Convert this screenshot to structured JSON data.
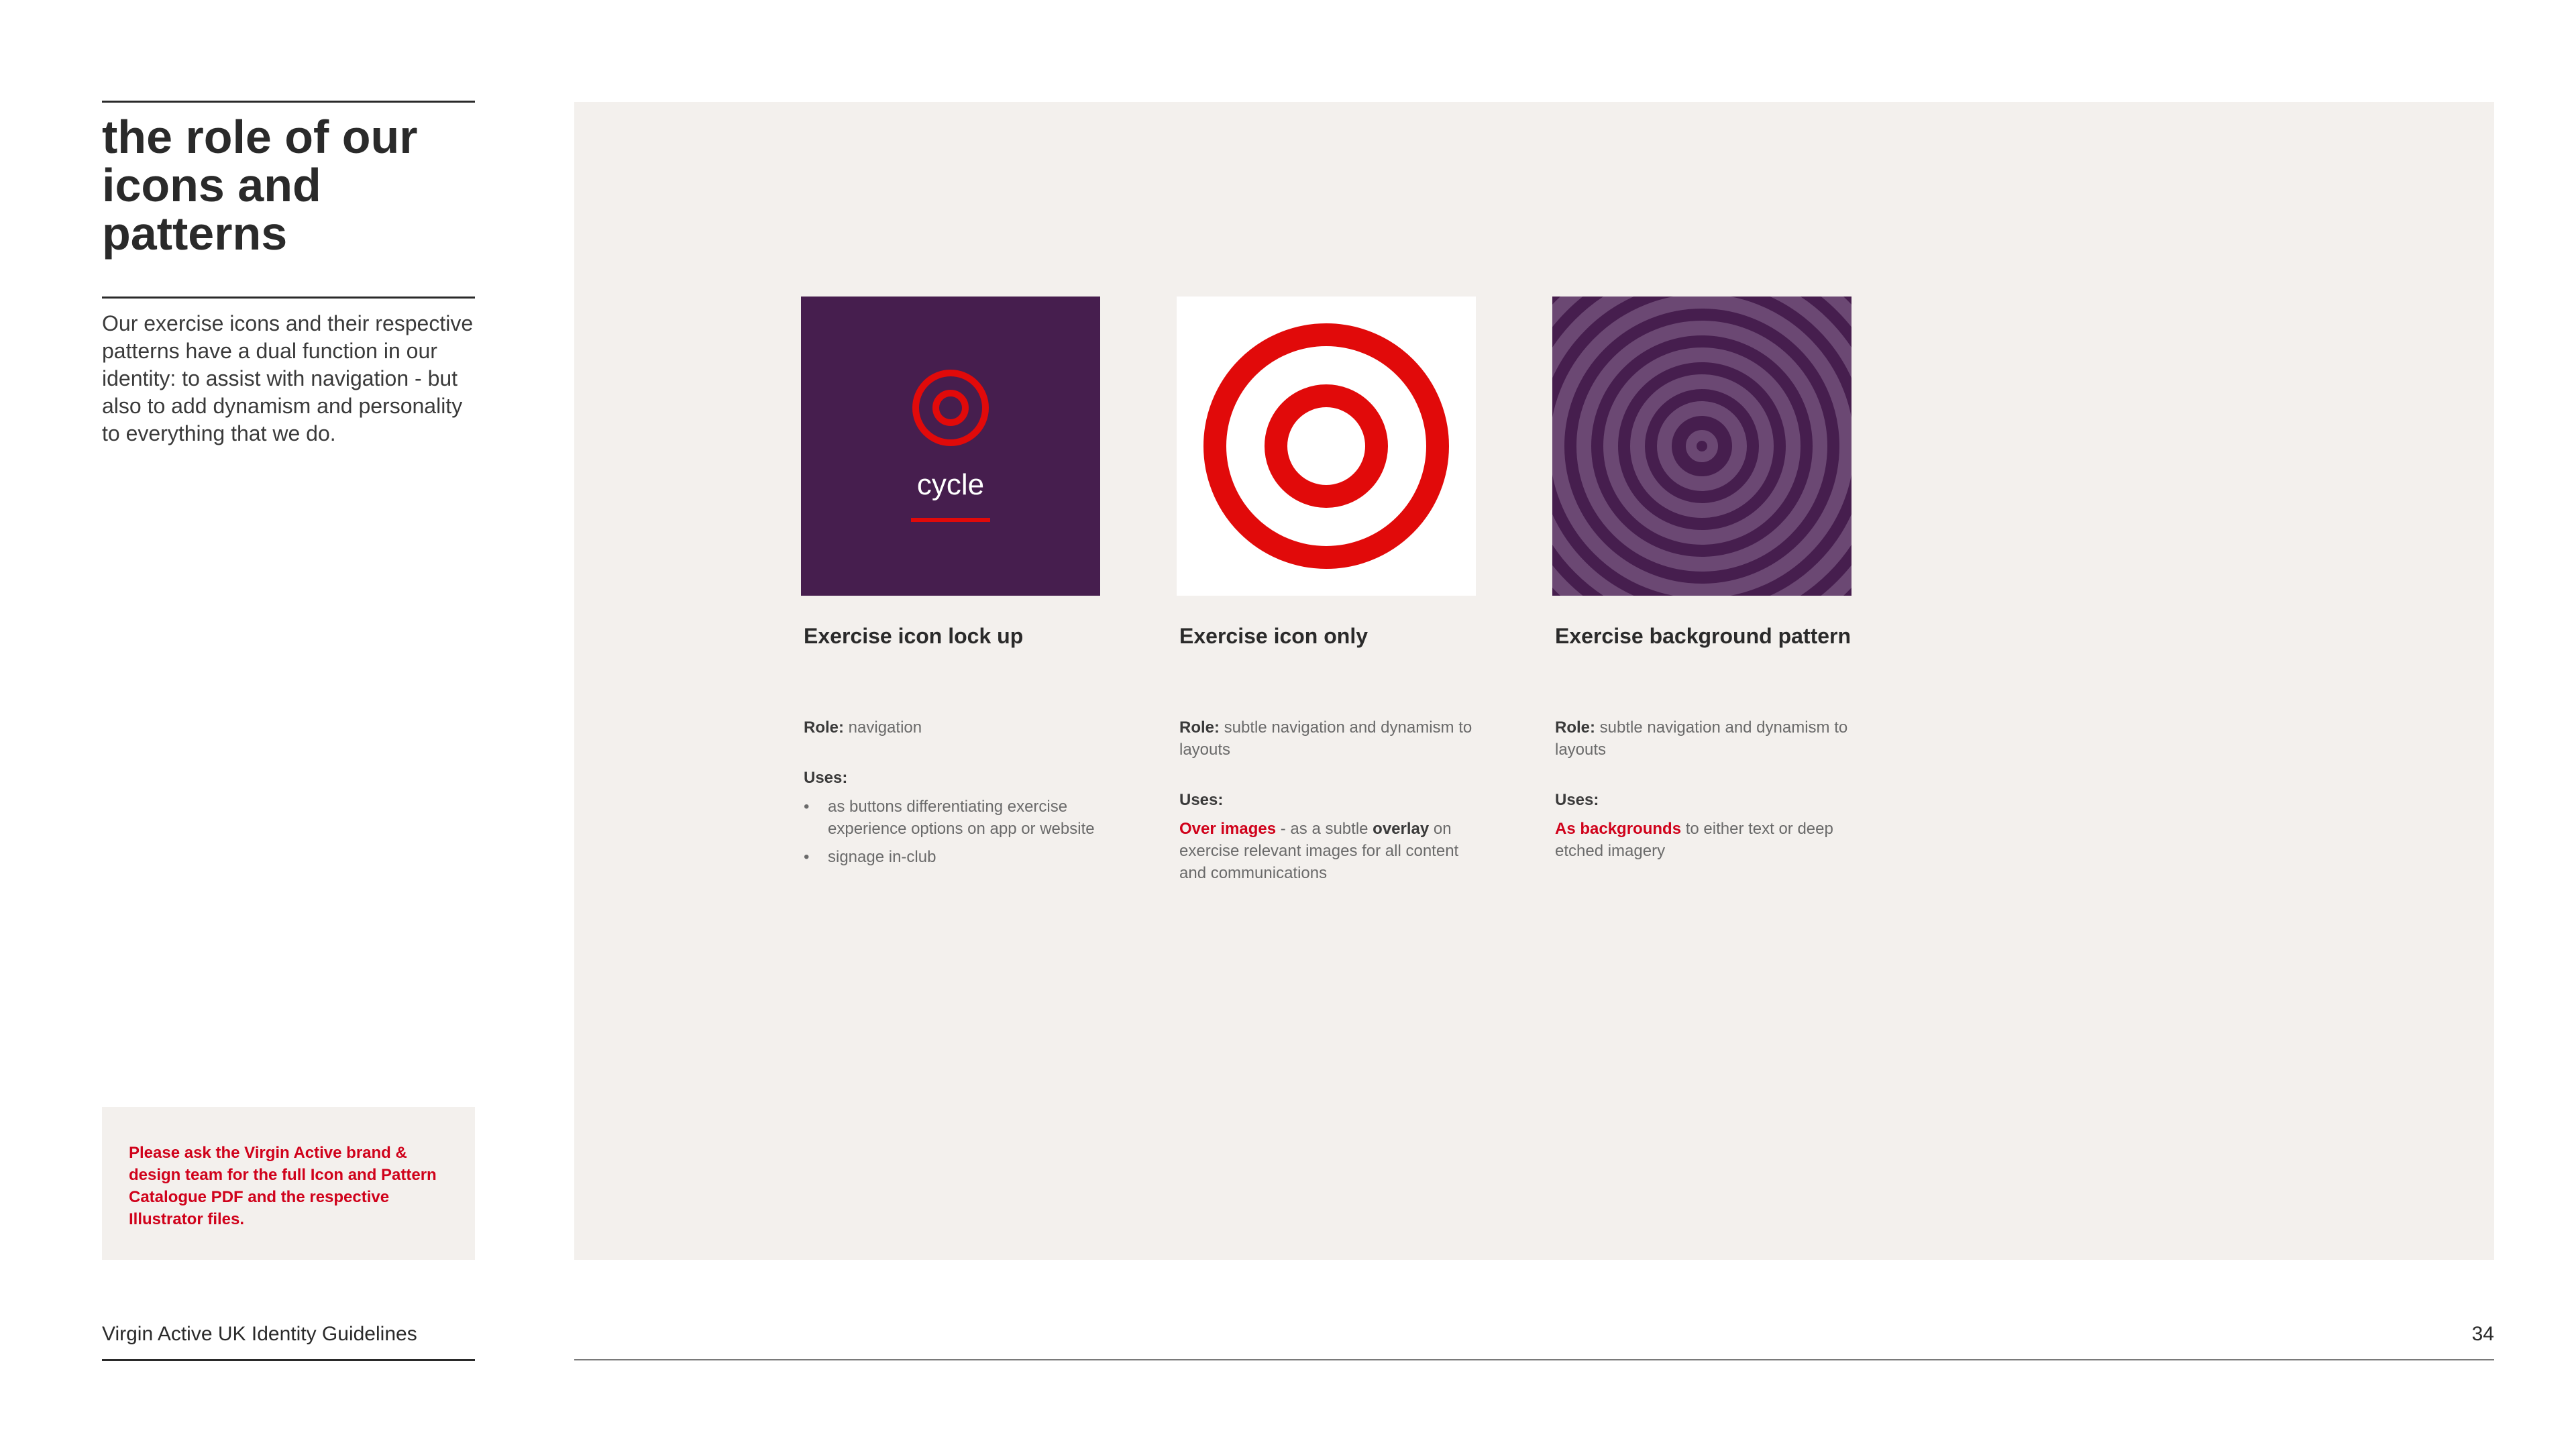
{
  "title": "the role of our icons and patterns",
  "intro": "Our exercise icons and their respective patterns have a dual function in our identity: to assist with navigation - but also to add dynamism and personality to everything that we do.",
  "notice": "Please ask the Virgin Active brand & design team for the full Icon and Pattern Catalogue PDF and the respective Illustrator files.",
  "footer": {
    "title": "Virgin Active UK Identity Guidelines",
    "page": "34"
  },
  "colors": {
    "brand_red": "#e10a0a",
    "purple": "#461e4e",
    "panel": "#f3f0ed",
    "pattern_ring": "#6b4873"
  },
  "tiles": {
    "lockup": {
      "label": "cycle",
      "icon": "target-icon"
    },
    "icon_only": {
      "icon": "target-icon"
    },
    "pattern": {
      "icon": "concentric-rings-pattern"
    }
  },
  "columns": [
    {
      "heading": "Exercise icon lock up",
      "role_label": "Role:",
      "role": "navigation",
      "uses_label": "Uses:",
      "uses": [
        "as buttons differentiating exercise experience options on app or website",
        "signage in-club"
      ]
    },
    {
      "heading": "Exercise icon only",
      "role_label": "Role:",
      "role": "subtle navigation and dynamism to layouts",
      "uses_label": "Uses:",
      "uses_highlight": "Over images",
      "uses_mid": " - as a subtle ",
      "uses_bold": "overlay",
      "uses_rest": " on exercise relevant images for all content and communications"
    },
    {
      "heading": "Exercise background pattern",
      "role_label": "Role:",
      "role": "subtle navigation and dynamism to layouts",
      "uses_label": "Uses:",
      "uses_highlight": "As backgrounds",
      "uses_rest": " to either text or deep etched imagery"
    }
  ]
}
